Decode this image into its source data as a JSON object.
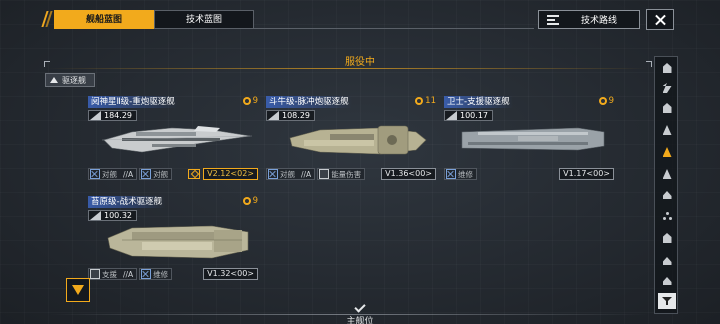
{
  "header": {
    "tabs": [
      {
        "label": "舰船蓝图",
        "active": true
      },
      {
        "label": "技术蓝图",
        "active": false
      }
    ],
    "route_button_label": "技术路线"
  },
  "section": {
    "title": "服役中",
    "filter_label": "驱逐舰"
  },
  "ships": [
    {
      "name": "阋神星Ⅱ级-重炮驱逐舰",
      "cost": "9",
      "size": "184.29",
      "tags": [
        {
          "label": "对舰",
          "grade": "//A"
        },
        {
          "label": "对舰",
          "grade": ""
        }
      ],
      "version": "V2.12<02>",
      "highlight": true
    },
    {
      "name": "斗牛级-脉冲炮驱逐舰",
      "cost": "11",
      "size": "108.29",
      "tags": [
        {
          "label": "对舰",
          "grade": "//A"
        },
        {
          "label": "能量伤害",
          "grade": ""
        }
      ],
      "version": "V1.36<00>",
      "highlight": false
    },
    {
      "name": "卫士-支援驱逐舰",
      "cost": "9",
      "size": "100.17",
      "tags": [
        {
          "label": "维修",
          "grade": ""
        }
      ],
      "version": "V1.17<00>",
      "highlight": false
    },
    {
      "name": "苔原级-战术驱逐舰",
      "cost": "9",
      "size": "100.32",
      "tags": [
        {
          "label": "支援",
          "grade": "//A"
        },
        {
          "label": "维修",
          "grade": ""
        }
      ],
      "version": "V1.32<00>",
      "highlight": false
    }
  ],
  "sidebar": {
    "items": [
      "hangar-icon",
      "carrier-icon",
      "battleship-icon",
      "cruiser-icon",
      "destroyer-icon",
      "frigate-icon",
      "corvette-icon",
      "fighter-icon",
      "drone-icon",
      "station-icon",
      "support-icon"
    ],
    "active_index": 4
  },
  "footer": {
    "title": "主舰位"
  },
  "colors": {
    "accent": "#f2aa1c",
    "name_bar": "#3c64be",
    "background": "#2b3139"
  }
}
